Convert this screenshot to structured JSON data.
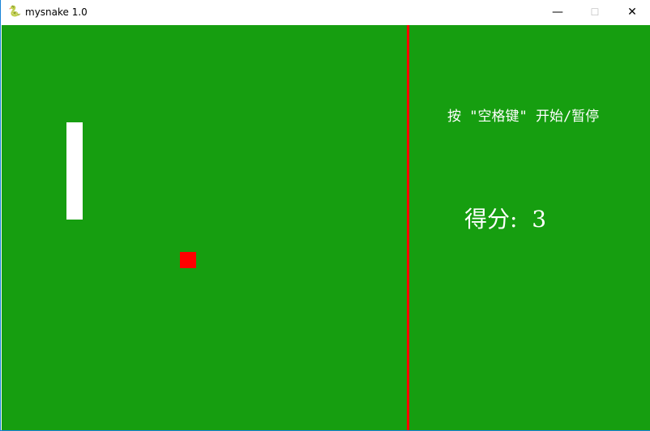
{
  "window": {
    "title": "mysnake 1.0",
    "app_icon": "pygame-snake-icon",
    "minimize": "—",
    "maximize": "☐",
    "close": "✕"
  },
  "game": {
    "hint": "按 \"空格键\" 开始/暂停",
    "score_label": "得分:",
    "score": "3",
    "colors": {
      "background": "#169e10",
      "divider": "#ff0000",
      "snake": "#ffffff",
      "food": "#ff0000"
    }
  }
}
